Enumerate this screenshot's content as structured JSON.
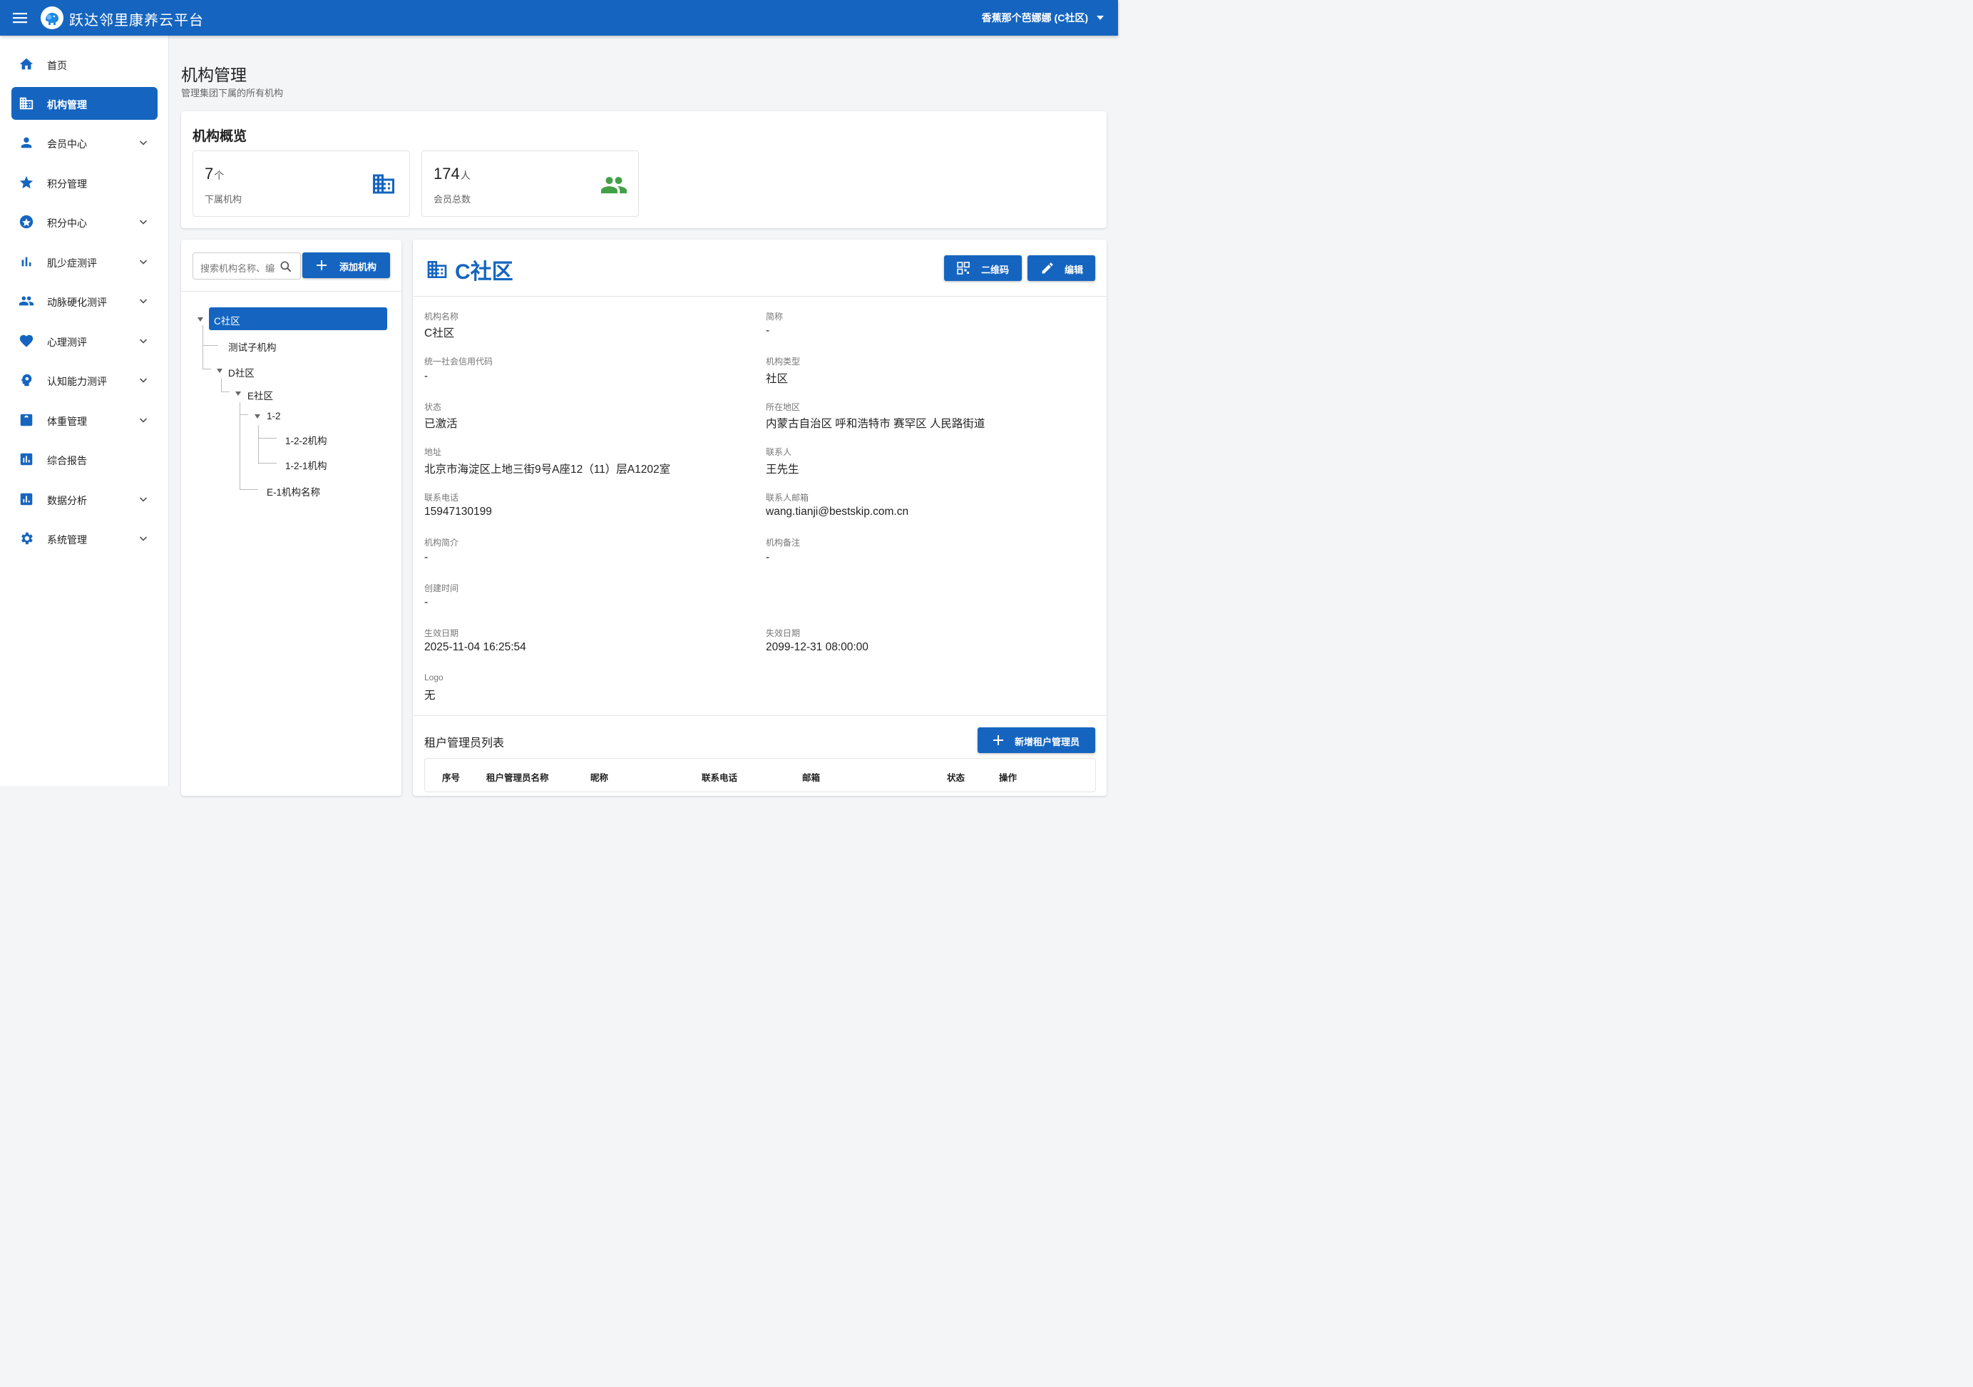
{
  "topbar": {
    "title": "跃达邻里康养云平台",
    "user": "香蕉那个芭娜娜 (C社区)"
  },
  "sidebar": {
    "items": [
      {
        "label": "首页",
        "icon": "home-icon"
      },
      {
        "label": "机构管理",
        "icon": "building-icon",
        "active": true
      },
      {
        "label": "会员中心",
        "icon": "person-icon"
      },
      {
        "label": "积分管理",
        "icon": "star-icon"
      },
      {
        "label": "积分中心",
        "icon": "star-circle-icon"
      },
      {
        "label": "肌少症测评",
        "icon": "bar-chart-icon"
      },
      {
        "label": "动脉硬化测评",
        "icon": "people-icon"
      },
      {
        "label": "心理测评",
        "icon": "heart-icon"
      },
      {
        "label": "认知能力测评",
        "icon": "brain-icon"
      },
      {
        "label": "体重管理",
        "icon": "scale-icon"
      },
      {
        "label": "综合报告",
        "icon": "report-icon"
      },
      {
        "label": "数据分析",
        "icon": "analytics-icon"
      },
      {
        "label": "系统管理",
        "icon": "gear-icon"
      }
    ]
  },
  "page": {
    "title": "机构管理",
    "subtitle": "管理集团下属的所有机构"
  },
  "overview": {
    "title": "机构概览",
    "stats": [
      {
        "value": "7",
        "unit": "个",
        "caption": "下属机构",
        "icon": "building-icon",
        "color": "#1565c0"
      },
      {
        "value": "174",
        "unit": "人",
        "caption": "会员总数",
        "icon": "people-icon",
        "color": "#43a047"
      }
    ]
  },
  "tree": {
    "search_placeholder": "搜索机构名称、编码",
    "add_label": "添加机构",
    "nodes": [
      "C社区",
      "测试子机构",
      "D社区",
      "E社区",
      "1-2",
      "1-2-2机构",
      "1-2-1机构",
      "E-1机构名称"
    ]
  },
  "detail": {
    "name": "C社区",
    "qr_label": "二维码",
    "edit_label": "编辑",
    "fields": [
      {
        "label": "机构名称",
        "value": "C社区"
      },
      {
        "label": "简称",
        "value": "-"
      },
      {
        "label": "统一社会信用代码",
        "value": "-"
      },
      {
        "label": "机构类型",
        "value": "社区"
      },
      {
        "label": "状态",
        "value": "已激活"
      },
      {
        "label": "所在地区",
        "value": "内蒙古自治区 呼和浩特市 赛罕区 人民路街道"
      },
      {
        "label": "地址",
        "value": "北京市海淀区上地三街9号A座12（11）层A1202室"
      },
      {
        "label": "联系人",
        "value": "王先生"
      },
      {
        "label": "联系电话",
        "value": "15947130199"
      },
      {
        "label": "联系人邮箱",
        "value": "wang.tianji@bestskip.com.cn"
      },
      {
        "label": "机构简介",
        "value": "-"
      },
      {
        "label": "机构备注",
        "value": "-"
      },
      {
        "label": "创建时间",
        "value": "-"
      },
      {
        "label": "生效日期",
        "value": "2025-11-04 16:25:54"
      },
      {
        "label": "失效日期",
        "value": "2099-12-31 08:00:00"
      },
      {
        "label": "Logo",
        "value": "无"
      }
    ]
  },
  "admins": {
    "title": "租户管理员列表",
    "add_label": "新增租户管理员",
    "columns": [
      "序号",
      "租户管理员名称",
      "昵称",
      "联系电话",
      "邮箱",
      "状态",
      "操作"
    ]
  }
}
